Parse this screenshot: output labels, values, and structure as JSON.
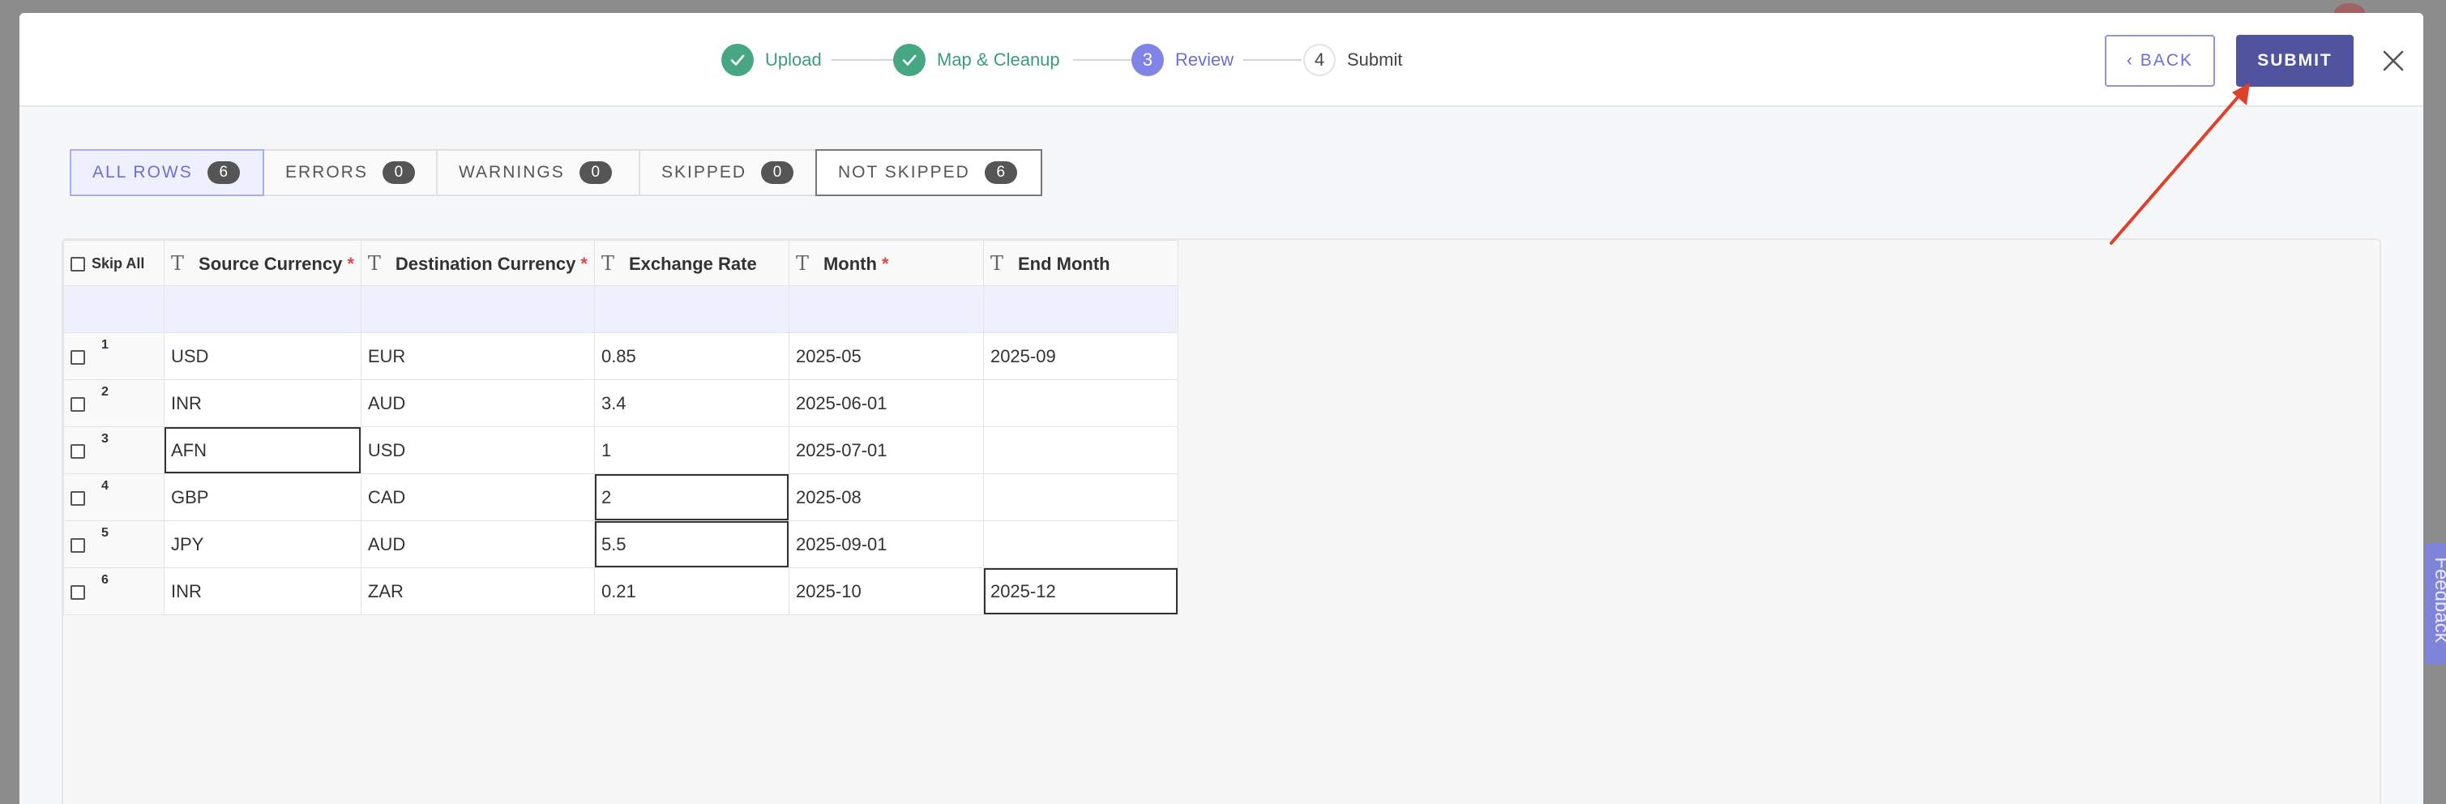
{
  "stepper": {
    "steps": [
      {
        "label": "Upload",
        "state": "done",
        "number": ""
      },
      {
        "label": "Map & Cleanup",
        "state": "done",
        "number": ""
      },
      {
        "label": "Review",
        "state": "active",
        "number": "3"
      },
      {
        "label": "Submit",
        "state": "todo",
        "number": "4"
      }
    ]
  },
  "header": {
    "back_label": "‹ BACK",
    "submit_label": "SUBMIT"
  },
  "filters": [
    {
      "label": "ALL ROWS",
      "count": "6"
    },
    {
      "label": "ERRORS",
      "count": "0"
    },
    {
      "label": "WARNINGS",
      "count": "0"
    },
    {
      "label": "SKIPPED",
      "count": "0"
    },
    {
      "label": "NOT SKIPPED",
      "count": "6"
    }
  ],
  "grid": {
    "skip_all_label": "Skip All",
    "columns": [
      {
        "label": "Source Currency",
        "required": "*"
      },
      {
        "label": "Destination Currency",
        "required": "*"
      },
      {
        "label": "Exchange Rate",
        "required": ""
      },
      {
        "label": "Month",
        "required": "*"
      },
      {
        "label": "End Month",
        "required": ""
      }
    ],
    "rows": [
      {
        "num": "1",
        "cells": [
          "USD",
          "EUR",
          "0.85",
          "2025-05",
          "2025-09"
        ]
      },
      {
        "num": "2",
        "cells": [
          "INR",
          "AUD",
          "3.4",
          "2025-06-01",
          ""
        ]
      },
      {
        "num": "3",
        "cells": [
          "AFN",
          "USD",
          "1",
          "2025-07-01",
          ""
        ]
      },
      {
        "num": "4",
        "cells": [
          "GBP",
          "CAD",
          "2",
          "2025-08",
          ""
        ]
      },
      {
        "num": "5",
        "cells": [
          "JPY",
          "AUD",
          "5.5",
          "2025-09-01",
          ""
        ]
      },
      {
        "num": "6",
        "cells": [
          "INR",
          "ZAR",
          "0.21",
          "2025-10",
          "2025-12"
        ]
      }
    ]
  },
  "feedback_label": "Feedback",
  "colors": {
    "accent": "#6b6fd6",
    "submit_bg": "#50549e",
    "done_green": "#48a783",
    "arrow_red": "#e0402a"
  }
}
